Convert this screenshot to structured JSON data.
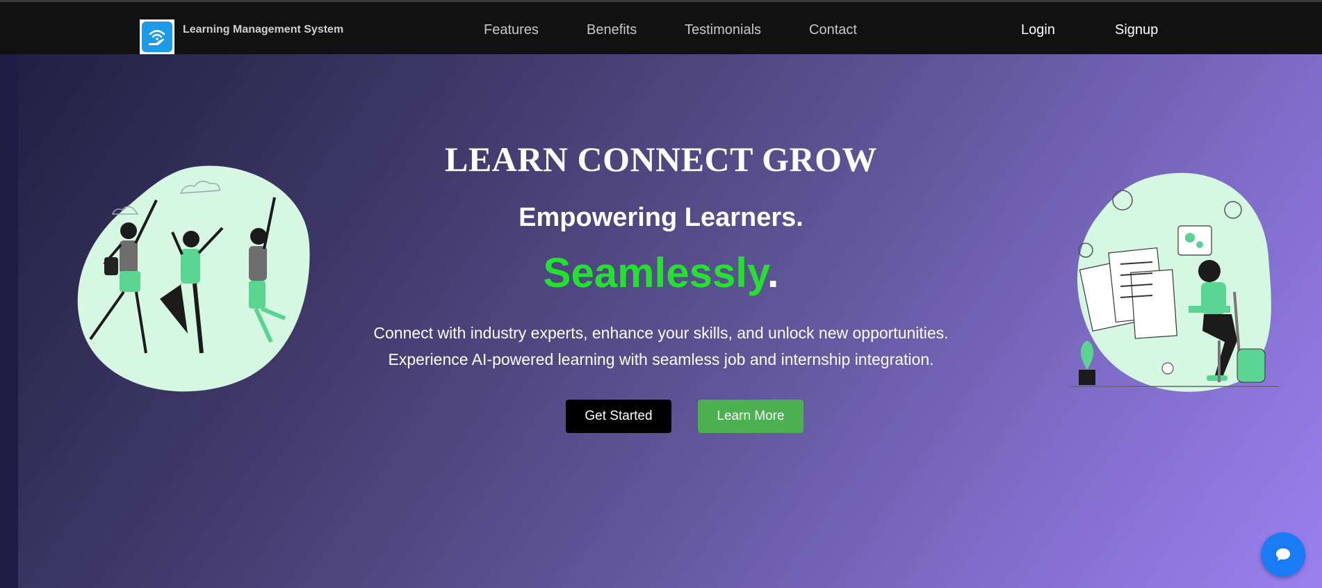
{
  "nav": {
    "brand": "Learning Management System",
    "logo_icon": "wifi-hand-icon",
    "links": [
      "Features",
      "Benefits",
      "Testimonials",
      "Contact"
    ],
    "login": "Login",
    "signup": "Signup"
  },
  "hero": {
    "title": "LEARN CONNECT GROW",
    "subtitle": "Empowering Learners.",
    "accent": "Seamlessly",
    "accent_suffix": ".",
    "desc_line1": "Connect with industry experts, enhance your skills, and unlock new opportunities.",
    "desc_line2": "Experience AI-powered learning with seamless job and internship integration.",
    "btn_start": "Get Started",
    "btn_learn": "Learn More"
  },
  "illustrations": {
    "left": "students-jumping-illustration",
    "right": "student-studying-illustration"
  },
  "chat": {
    "icon": "chat-bubble-icon"
  },
  "colors": {
    "nav_bg": "#111111",
    "accent_green": "#22e22e",
    "btn_learn_bg": "#4caf50",
    "chat_bg": "#1a7cf5",
    "hero_gradient_start": "#1f2142",
    "hero_gradient_end": "#9a80ef"
  }
}
